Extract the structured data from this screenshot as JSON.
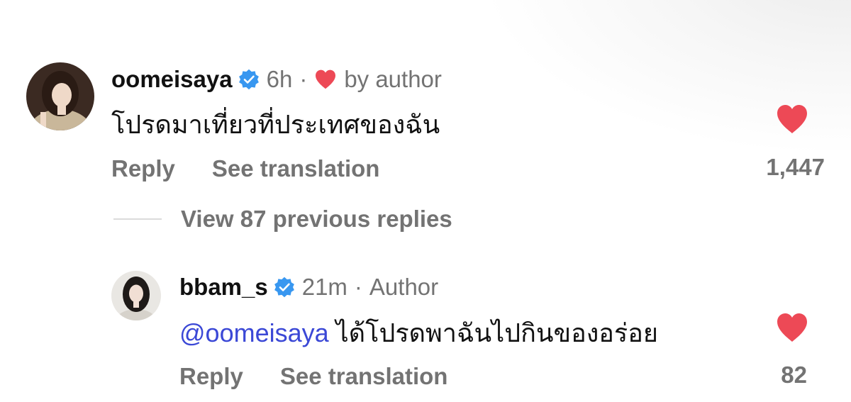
{
  "comments": [
    {
      "username": "oomeisaya",
      "time": "6h",
      "separator": "·",
      "by_author": "by author",
      "text": "โปรดมาเที่ยวที่ประเทศของฉัน",
      "reply_label": "Reply",
      "translate_label": "See translation",
      "likes": "1,447"
    }
  ],
  "view_replies": "View 87 previous replies",
  "reply": {
    "username": "bbam_s",
    "time": "21m",
    "separator": "·",
    "author_tag": "Author",
    "mention": "@oomeisaya",
    "text": " ได้โปรดพาฉันไปกินของอร่อย",
    "reply_label": "Reply",
    "translate_label": "See translation",
    "likes": "82"
  },
  "colors": {
    "heart": "#ed4956",
    "verified": "#3897f0",
    "muted": "#737373",
    "mention": "#3b48d6"
  },
  "icons": [
    "verified-badge-icon",
    "heart-icon"
  ]
}
